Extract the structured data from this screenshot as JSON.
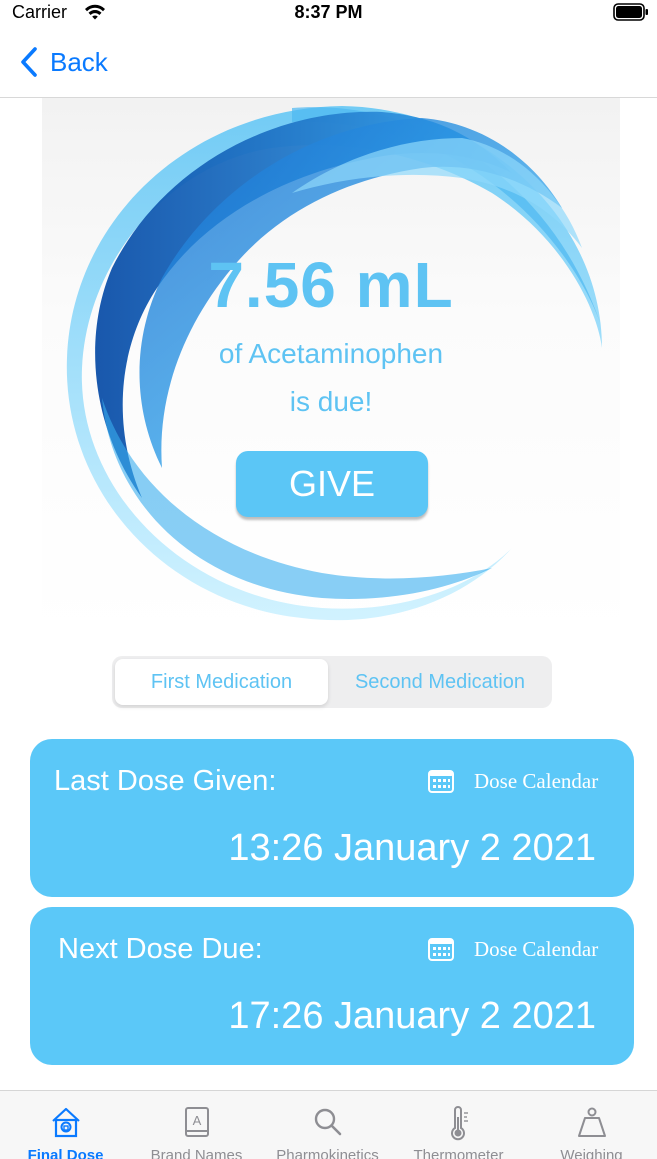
{
  "status_bar": {
    "carrier": "Carrier",
    "time": "8:37 PM",
    "icons": [
      "wifi-icon",
      "battery-icon"
    ]
  },
  "nav": {
    "back_label": "Back",
    "back_icon": "chevron-left-icon"
  },
  "dose": {
    "amount": "7.56 mL",
    "drug_line": "of Acetaminophen",
    "due_line": "is due!",
    "give_label": "GIVE"
  },
  "segments": {
    "first": "First Medication",
    "second": "Second Medication",
    "selected": "First Medication"
  },
  "last_dose": {
    "label": "Last Dose Given:",
    "calendar_label": "Dose Calendar",
    "time": "13:26 January 2 2021"
  },
  "next_dose": {
    "label": "Next Dose Due:",
    "calendar_label": "Dose Calendar",
    "time": "17:26 January 2 2021"
  },
  "tabs": [
    {
      "label": "Final Dose",
      "icon": "home-icon",
      "active": true
    },
    {
      "label": "Brand Names",
      "icon": "book-icon",
      "active": false
    },
    {
      "label": "Pharmokinetics",
      "icon": "search-icon",
      "active": false
    },
    {
      "label": "Thermometer",
      "icon": "thermometer-icon",
      "active": false
    },
    {
      "label": "Weighing",
      "icon": "scale-icon",
      "active": false
    }
  ],
  "colors": {
    "accent": "#5ec3f3",
    "card": "#5bc8f8",
    "ios_blue": "#0a7aff",
    "tab_inactive": "#8e8e93"
  }
}
